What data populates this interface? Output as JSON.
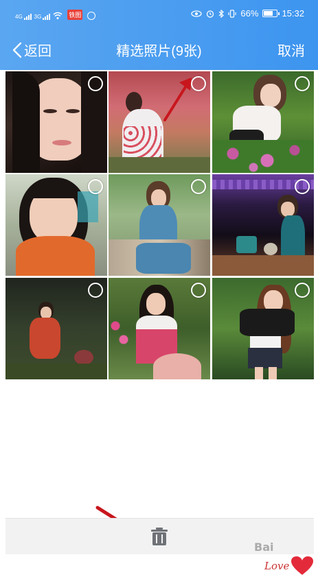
{
  "status_bar": {
    "signal_1_label": "4G",
    "signal_2_label": "3G",
    "badge": "铁图",
    "battery": "66%",
    "time": "15:32"
  },
  "nav": {
    "back_label": "返回",
    "title": "精选照片(9张)",
    "cancel_label": "取消"
  },
  "photos": [
    {
      "label": "photo-1",
      "selected": false
    },
    {
      "label": "photo-2",
      "selected": false
    },
    {
      "label": "photo-3",
      "selected": false
    },
    {
      "label": "photo-4",
      "selected": false
    },
    {
      "label": "photo-5",
      "selected": false
    },
    {
      "label": "photo-6",
      "selected": false
    },
    {
      "label": "photo-7",
      "selected": false
    },
    {
      "label": "photo-8",
      "selected": false
    },
    {
      "label": "photo-9",
      "selected": false
    }
  ],
  "toolbar": {
    "delete_icon": "trash-icon"
  },
  "watermark": {
    "text": "Bai",
    "sub": "Love"
  },
  "colors": {
    "header": "#4a9ff0",
    "annotation_arrow": "#c8161d",
    "toolbar_bg": "#f2f2f2"
  }
}
